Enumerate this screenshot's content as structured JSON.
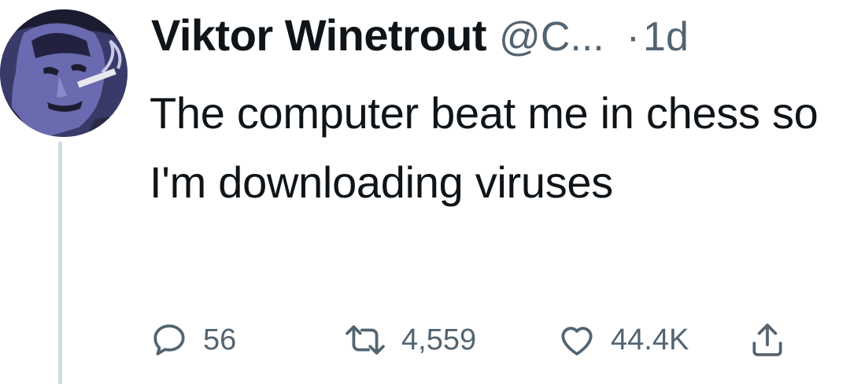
{
  "tweet": {
    "author": {
      "display_name": "Viktor Winetrout",
      "handle": "@C...",
      "avatar_icon": "avatar-illustration"
    },
    "separator": "·",
    "time": "1d",
    "text": "The computer beat me in chess so I'm downloading viruses",
    "actions": {
      "reply": {
        "icon": "reply-icon",
        "count": "56"
      },
      "retweet": {
        "icon": "retweet-icon",
        "count": "4,559"
      },
      "like": {
        "icon": "heart-icon",
        "count": "44.4K"
      },
      "share": {
        "icon": "share-icon"
      }
    }
  },
  "colors": {
    "text_primary": "#0f1419",
    "text_secondary": "#536471",
    "thread_line": "#cfd9de",
    "background": "#ffffff"
  }
}
